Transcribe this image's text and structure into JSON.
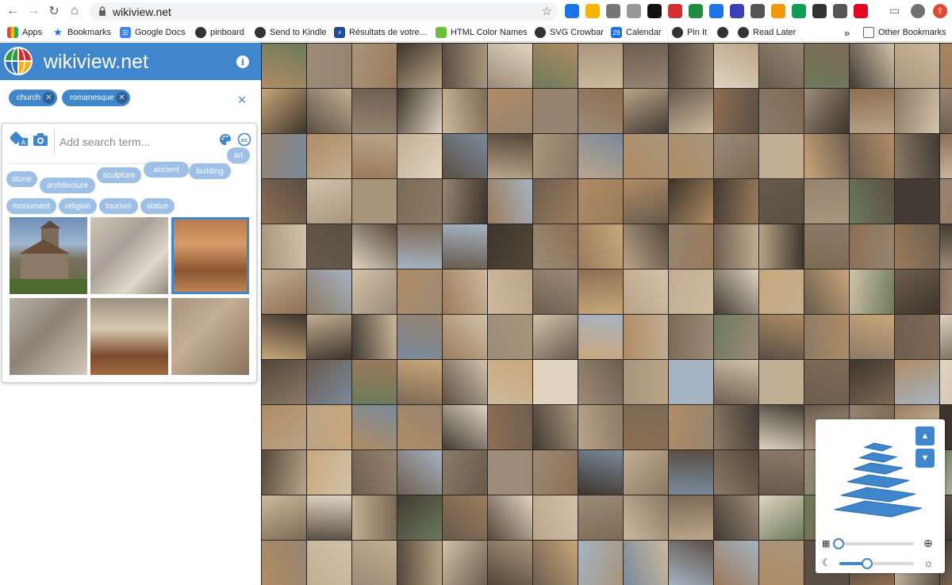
{
  "browser": {
    "url": "wikiview.net",
    "bookmarks": [
      "Apps",
      "Bookmarks",
      "Google Docs",
      "pinboard",
      "Send to Kindle",
      "Résultats de votre...",
      "HTML Color Names",
      "SVG Crowbar",
      "Calendar",
      "Pin It",
      "Read Later"
    ],
    "overflow": "»",
    "other_bookmarks": "Other Bookmarks",
    "calendar_day": "29",
    "colors": {
      "ext": [
        "#1a73e8",
        "#f7b500",
        "#777777",
        "#999999",
        "#111111",
        "#d32f2f",
        "#1e8e3e",
        "#1a73e8",
        "#3c3fb6",
        "#555555",
        "#f29900",
        "#0f9d58",
        "#333333",
        "#555555",
        "#e60023"
      ]
    }
  },
  "app": {
    "title": "wikiview.net",
    "accent": "#3f86cc",
    "chips": [
      {
        "label": "church"
      },
      {
        "label": "romanesque"
      }
    ],
    "search": {
      "placeholder": "Add search term..."
    },
    "suggestions": [
      "stone",
      "architecture",
      "sculpture",
      "ancient",
      "building",
      "art",
      "monument",
      "religion",
      "tourism",
      "statue"
    ],
    "results": [
      {
        "bg": "linear-gradient(180deg,#6f8fb6 0%,#9fb6cf 35%,#7a7060 55%,#5b6a3c 100%)",
        "selected": false
      },
      {
        "bg": "linear-gradient(135deg,#cfc6b8 0%,#a8a096 40%,#e0d8cc 70%,#8f887e 100%)",
        "selected": false
      },
      {
        "bg": "linear-gradient(180deg,#b5784a 0%,#d79c6a 35%,#8a5530 70%,#c58a5a 100%)",
        "selected": true
      },
      {
        "bg": "linear-gradient(135deg,#b8b0a6 0%,#8e8276 45%,#d4c8b8 100%)",
        "selected": false
      },
      {
        "bg": "linear-gradient(180deg,#9b8f80 0%,#d8c9b0 40%,#7a4a2e 75%,#a06a40 100%)",
        "selected": false
      },
      {
        "bg": "linear-gradient(135deg,#a89480 0%,#c3ad94 40%,#8a735e 100%)",
        "selected": false
      }
    ]
  }
}
